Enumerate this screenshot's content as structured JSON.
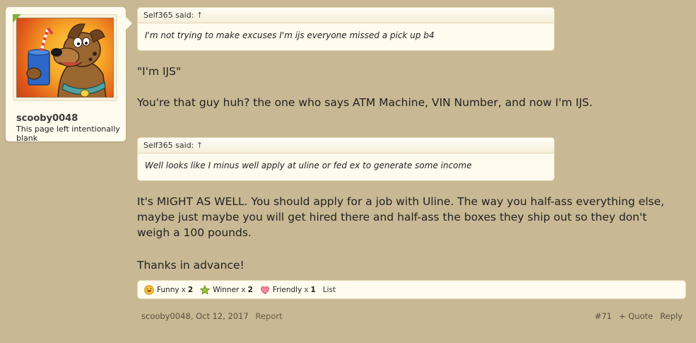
{
  "user": {
    "name": "scooby0048",
    "title": "This page left intentionally blank"
  },
  "quotes": [
    {
      "attribution": "Self365 said:",
      "arrow": "↑",
      "text": "I'm not trying to make excuses I'm ijs everyone missed a pick up b4"
    },
    {
      "attribution": "Self365 said:",
      "arrow": "↑",
      "text": "Well looks like I minus well apply at uline or fed ex to generate some income"
    }
  ],
  "message": {
    "p1": "\"I'm IJS\"",
    "p2": "You're that guy huh? the one who says ATM Machine, VIN Number, and now I'm IJS.",
    "p3": "It's MIGHT AS WELL. You should apply for a job with Uline. The way you half-ass everything else, maybe just maybe you will get hired there and half-ass the boxes they ship out so they don't weigh a 100 pounds.",
    "p4": "Thanks in advance!"
  },
  "ratings": [
    {
      "label": "Funny",
      "x": "x",
      "count": "2",
      "icon": "laughing-face-icon"
    },
    {
      "label": "Winner",
      "x": "x",
      "count": "2",
      "icon": "winner-star-icon"
    },
    {
      "label": "Friendly",
      "x": "x",
      "count": "1",
      "icon": "heart-icon"
    }
  ],
  "ratings_list_label": "List",
  "footer": {
    "author_date": "scooby0048, Oct 12, 2017",
    "report": "Report",
    "post_number": "#71",
    "quote": "+ Quote",
    "reply": "Reply"
  },
  "colors": {
    "page_bg": "#c8b893",
    "card_bg": "#fffbee",
    "avatar_badge": "#7db045"
  }
}
